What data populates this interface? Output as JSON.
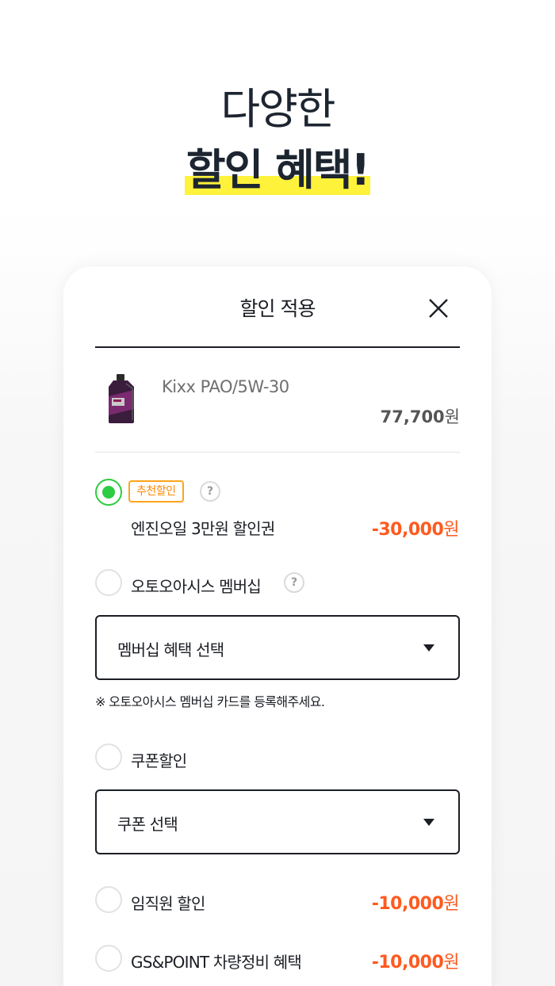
{
  "headline": {
    "line1": "다양한",
    "line2": "할인 혜택!"
  },
  "modal": {
    "title": "할인 적용",
    "close_icon": "close-icon"
  },
  "product": {
    "name": "Kixx PAO/5W-30",
    "price": "77,700",
    "currency": "원",
    "image_icon": "engine-oil-bottle"
  },
  "options": {
    "recommended": {
      "badge": "추천할인",
      "label": "엔진오일 3만원 할인권",
      "amount": "-30,000",
      "currency": "원",
      "selected": true
    },
    "membership": {
      "label": "오토오아시스 멤버십",
      "select_value": "멤버십 혜택 선택",
      "note": "※ 오토오아시스 멤버십 카드를 등록해주세요.",
      "selected": false
    },
    "coupon": {
      "label": "쿠폰할인",
      "select_value": "쿠폰 선택",
      "selected": false
    },
    "employee": {
      "label": "임직원 할인",
      "amount": "-10,000",
      "currency": "원",
      "selected": false
    },
    "gs_point": {
      "label": "GS&POINT 차량정비 혜택",
      "amount": "-10,000",
      "currency": "원",
      "selected": false
    }
  },
  "help_glyph": "?",
  "colors": {
    "accent_green": "#2ecc40",
    "discount_orange": "#ff5a1f",
    "badge_orange": "#ffa41b",
    "highlight_yellow": "#fff23a",
    "text_dark": "#1b1e24"
  }
}
